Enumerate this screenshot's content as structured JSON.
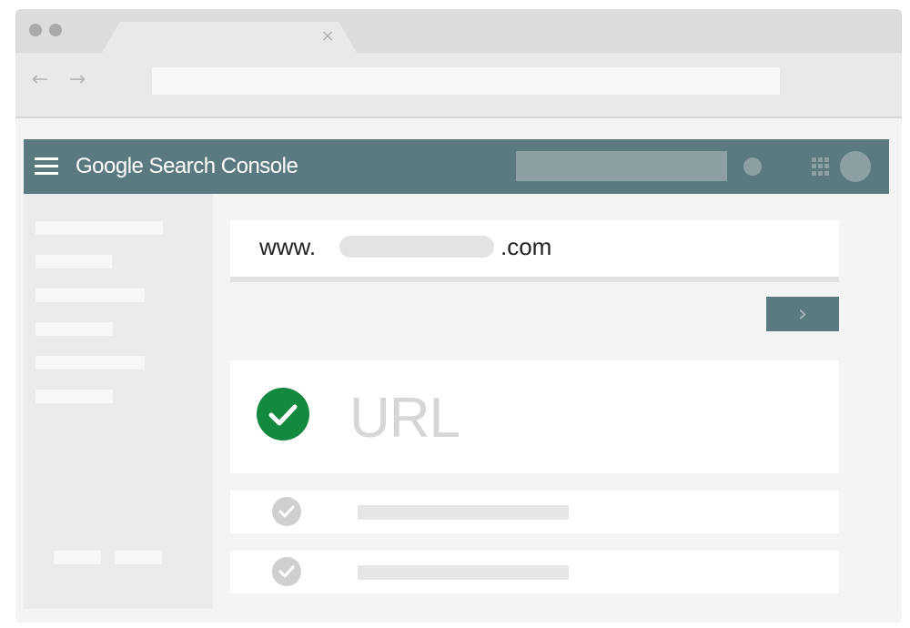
{
  "browser": {
    "tab": {
      "close_glyph": "×"
    },
    "nav": {
      "back_glyph": "←",
      "forward_glyph": "→"
    }
  },
  "header": {
    "brand": "Google Search Console",
    "menu_icon": "hamburger-menu-icon",
    "apps_icon": "apps-grid-icon"
  },
  "inspection": {
    "url_prefix": "www.",
    "url_suffix": ".com",
    "submit_glyph": "›"
  },
  "result": {
    "label": "URL",
    "status_icon": "check-circle-icon",
    "status_color": "#12893f"
  },
  "colors": {
    "header": "#5a7a7f",
    "header_accent": "#8ca0a4"
  }
}
